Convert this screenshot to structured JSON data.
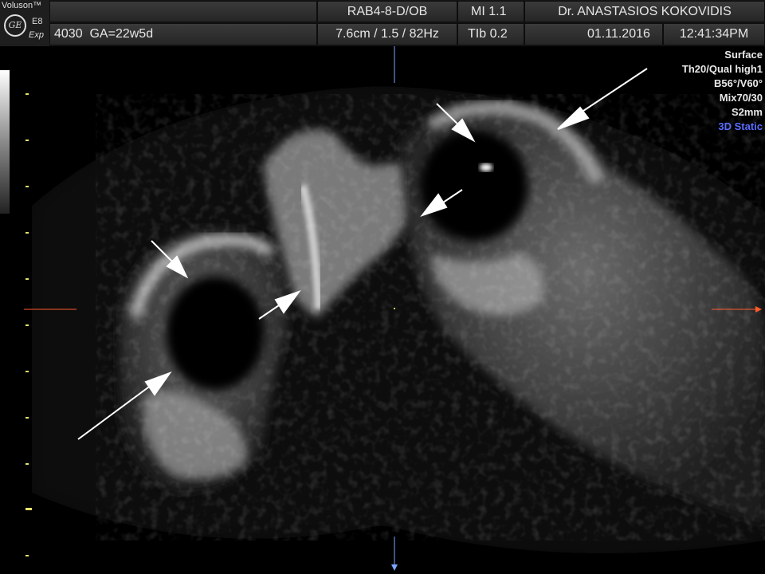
{
  "header": {
    "brand": "Voluson™",
    "ge_logo": "GE",
    "model": "E8",
    "edition": "Exp",
    "preset": "4030",
    "gestational_age": "GA=22w5d",
    "probe": "RAB4-8-D/OB",
    "depth_freq": "7.6cm / 1.5 / 82Hz",
    "mi": "MI  1.1",
    "tib": "TIb  0.2",
    "operator": "Dr. ANASTASIOS KOKOVIDIS",
    "date": "01.11.2016",
    "time": "12:41:34PM"
  },
  "render_params": [
    "Surface",
    "Th20/Qual high1",
    "B56°/V60°",
    "Mix70/30",
    "S2mm"
  ],
  "mode": "3D Static",
  "colors": {
    "mode": "#5a6cff",
    "tick": "#e6e36a",
    "marker": "#ff5a2a",
    "scan_line": "#7aa7ff"
  }
}
